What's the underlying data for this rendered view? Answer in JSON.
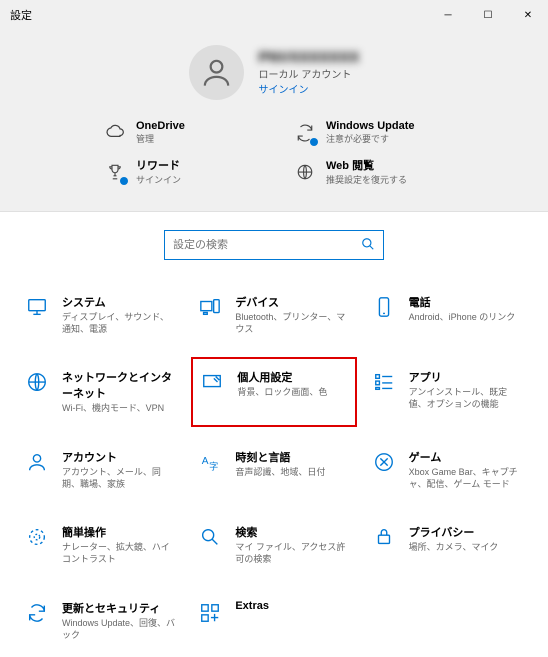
{
  "window": {
    "title": "設定"
  },
  "user": {
    "name": "PNVXXXXXXX",
    "sub": "ローカル アカウント",
    "link": "サインイン"
  },
  "quick": [
    {
      "title": "OneDrive",
      "sub": "管理",
      "icon": "cloud",
      "dot": false
    },
    {
      "title": "Windows Update",
      "sub": "注意が必要です",
      "icon": "refresh",
      "dot": true
    },
    {
      "title": "リワード",
      "sub": "サインイン",
      "icon": "trophy",
      "dot": true
    },
    {
      "title": "Web 閲覧",
      "sub": "推奨設定を復元する",
      "icon": "globe",
      "dot": false
    }
  ],
  "search": {
    "placeholder": "設定の検索"
  },
  "categories": [
    {
      "title": "システム",
      "sub": "ディスプレイ、サウンド、通知、電源",
      "icon": "system"
    },
    {
      "title": "デバイス",
      "sub": "Bluetooth、プリンター、マウス",
      "icon": "devices"
    },
    {
      "title": "電話",
      "sub": "Android、iPhone のリンク",
      "icon": "phone"
    },
    {
      "title": "ネットワークとインターネット",
      "sub": "Wi-Fi、機内モード、VPN",
      "icon": "network"
    },
    {
      "title": "個人用設定",
      "sub": "背景、ロック画面、色",
      "icon": "personalize",
      "highlight": true
    },
    {
      "title": "アプリ",
      "sub": "アンインストール、既定値、オプションの機能",
      "icon": "apps"
    },
    {
      "title": "アカウント",
      "sub": "アカウント、メール、同期、職場、家族",
      "icon": "account"
    },
    {
      "title": "時刻と言語",
      "sub": "音声認識、地域、日付",
      "icon": "time"
    },
    {
      "title": "ゲーム",
      "sub": "Xbox Game Bar、キャプチャ、配信、ゲーム モード",
      "icon": "game"
    },
    {
      "title": "簡単操作",
      "sub": "ナレーター、拡大鏡、ハイコントラスト",
      "icon": "ease"
    },
    {
      "title": "検索",
      "sub": "マイ ファイル、アクセス許可の検索",
      "icon": "search"
    },
    {
      "title": "プライバシー",
      "sub": "場所、カメラ、マイク",
      "icon": "privacy"
    },
    {
      "title": "更新とセキュリティ",
      "sub": "Windows Update、回復、バック",
      "icon": "update"
    },
    {
      "title": "Extras",
      "sub": "",
      "icon": "extras"
    }
  ]
}
